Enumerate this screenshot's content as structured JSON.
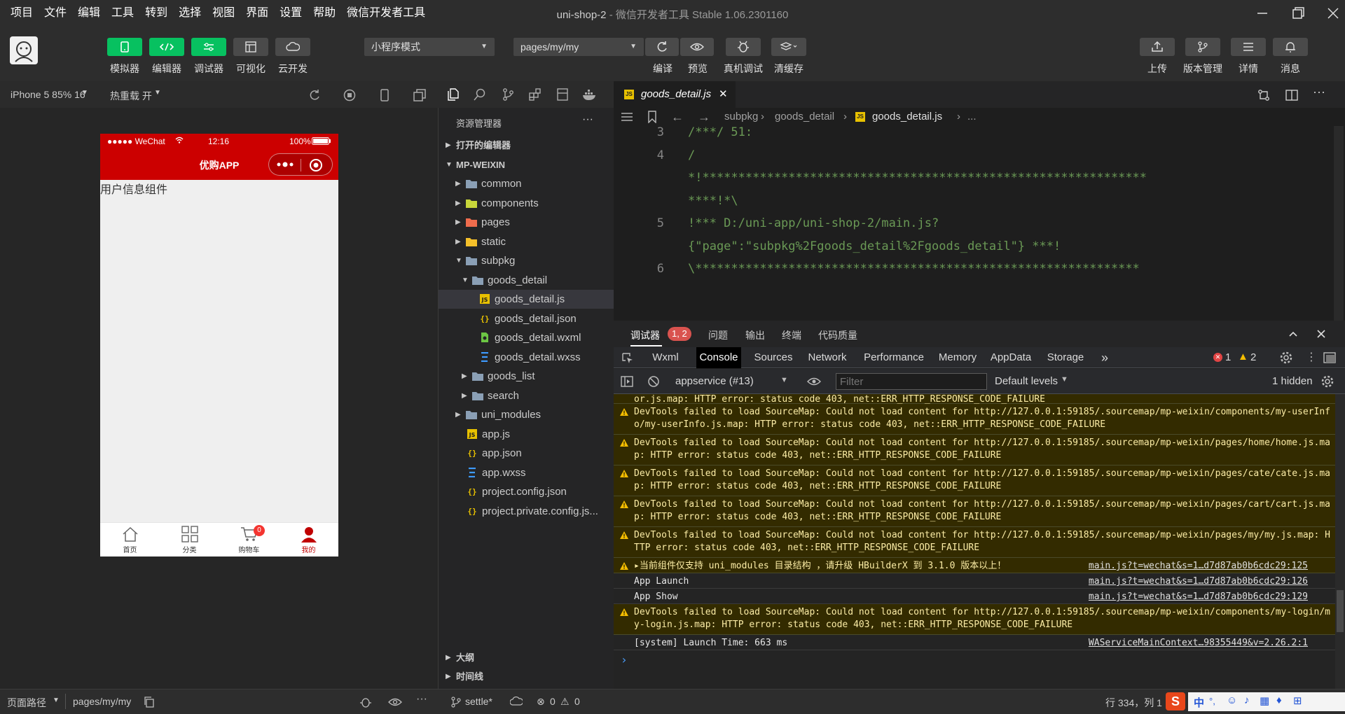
{
  "window": {
    "title": "uni-shop-2",
    "subtitle": "- 微信开发者工具 Stable 1.06.2301160"
  },
  "menu": [
    "项目",
    "文件",
    "编辑",
    "工具",
    "转到",
    "选择",
    "视图",
    "界面",
    "设置",
    "帮助",
    "微信开发者工具"
  ],
  "toolbar": {
    "simulator": "模拟器",
    "editor": "编辑器",
    "debugger": "调试器",
    "visual": "可视化",
    "cloud": "云开发",
    "mode_select": "小程序模式",
    "page_select": "pages/my/my",
    "compile": "编译",
    "preview": "预览",
    "real_debug": "真机调试",
    "clear_cache": "清缓存",
    "upload": "上传",
    "version": "版本管理",
    "details": "详情",
    "messages": "消息"
  },
  "simulator": {
    "device": "iPhone 5 85% 16",
    "hot_reload": "热重载 开",
    "status_carrier": "●●●●● WeChat",
    "status_time": "12:16",
    "status_battery": "100%",
    "nav_title": "优购APP",
    "content_text": "用户信息组件",
    "tabs": [
      {
        "label": "首页",
        "badge": ""
      },
      {
        "label": "分类",
        "badge": ""
      },
      {
        "label": "购物车",
        "badge": "0"
      },
      {
        "label": "我的",
        "badge": ""
      }
    ],
    "accent": "#cc0000"
  },
  "explorer": {
    "title": "资源管理器",
    "open_editors": "打开的编辑器",
    "root": "MP-WEIXIN",
    "items": [
      {
        "name": "common",
        "type": "folder"
      },
      {
        "name": "components",
        "type": "folder"
      },
      {
        "name": "pages",
        "type": "folder"
      },
      {
        "name": "static",
        "type": "folder"
      },
      {
        "name": "subpkg",
        "type": "folder"
      },
      {
        "name": "goods_detail",
        "type": "folder"
      },
      {
        "name": "goods_detail.js",
        "type": "js"
      },
      {
        "name": "goods_detail.json",
        "type": "json"
      },
      {
        "name": "goods_detail.wxml",
        "type": "wxml"
      },
      {
        "name": "goods_detail.wxss",
        "type": "wxss"
      },
      {
        "name": "goods_list",
        "type": "folder"
      },
      {
        "name": "search",
        "type": "folder"
      },
      {
        "name": "uni_modules",
        "type": "folder"
      },
      {
        "name": "app.js",
        "type": "js"
      },
      {
        "name": "app.json",
        "type": "json"
      },
      {
        "name": "app.wxss",
        "type": "wxss"
      },
      {
        "name": "project.config.json",
        "type": "json"
      },
      {
        "name": "project.private.config.js...",
        "type": "json"
      }
    ],
    "outline": "大纲",
    "timeline": "时间线"
  },
  "editor": {
    "tab": "goods_detail.js",
    "breadcrumb": [
      "subpkg",
      "goods_detail",
      "goods_detail.js",
      "..."
    ],
    "lines": [
      {
        "num": "3",
        "text": "/***/ 51:"
      },
      {
        "num": "4",
        "text": "/"
      },
      {
        "num": "",
        "text": "*!**************************************************************"
      },
      {
        "num": "",
        "text": "****!*\\"
      },
      {
        "num": "5",
        "text": "  !*** D:/uni-app/uni-shop-2/main.js?"
      },
      {
        "num": "",
        "text": "  {\"page\":\"subpkg%2Fgoods_detail%2Fgoods_detail\"} ***!"
      },
      {
        "num": "6",
        "text": "  \\**************************************************************"
      }
    ]
  },
  "debugger": {
    "title": "调试器",
    "badge": "1, 2",
    "tabs": [
      "问题",
      "输出",
      "终端",
      "代码质量"
    ],
    "devtools_tabs": [
      "Wxml",
      "Console",
      "Sources",
      "Network",
      "Performance",
      "Memory",
      "AppData",
      "Storage"
    ],
    "more": "»",
    "error_count": "1",
    "warn_count": "2",
    "context": "appservice (#13)",
    "filter_placeholder": "Filter",
    "levels": "Default levels",
    "hidden": "1 hidden",
    "messages": [
      {
        "type": "warn",
        "text": "or.js.map: HTTP error: status code 403, net::ERR_HTTP_RESPONSE_CODE_FAILURE",
        "src": ""
      },
      {
        "type": "warn",
        "text": "DevTools failed to load SourceMap: Could not load content for http://127.0.0.1:59185/.sourcemap/mp-weixin/components/my-userInfo/my-userInfo.js.map: HTTP error: status code 403, net::ERR_HTTP_RESPONSE_CODE_FAILURE",
        "src": ""
      },
      {
        "type": "warn",
        "text": "DevTools failed to load SourceMap: Could not load content for http://127.0.0.1:59185/.sourcemap/mp-weixin/pages/home/home.js.map: HTTP error: status code 403, net::ERR_HTTP_RESPONSE_CODE_FAILURE",
        "src": ""
      },
      {
        "type": "warn",
        "text": "DevTools failed to load SourceMap: Could not load content for http://127.0.0.1:59185/.sourcemap/mp-weixin/pages/cate/cate.js.map: HTTP error: status code 403, net::ERR_HTTP_RESPONSE_CODE_FAILURE",
        "src": ""
      },
      {
        "type": "warn",
        "text": "DevTools failed to load SourceMap: Could not load content for http://127.0.0.1:59185/.sourcemap/mp-weixin/pages/cart/cart.js.map: HTTP error: status code 403, net::ERR_HTTP_RESPONSE_CODE_FAILURE",
        "src": ""
      },
      {
        "type": "warn",
        "text": "DevTools failed to load SourceMap: Could not load content for http://127.0.0.1:59185/.sourcemap/mp-weixin/pages/my/my.js.map: HTTP error: status code 403, net::ERR_HTTP_RESPONSE_CODE_FAILURE",
        "src": ""
      },
      {
        "type": "warn",
        "text": "▸当前组件仅支持 uni_modules 目录结构 ，请升级 HBuilderX 到 3.1.0 版本以上！",
        "src": "main.js?t=wechat&s=1…d7d87ab0b6cdc29:125"
      },
      {
        "type": "log",
        "text": "App Launch",
        "src": "main.js?t=wechat&s=1…d7d87ab0b6cdc29:126"
      },
      {
        "type": "log",
        "text": "App Show",
        "src": "main.js?t=wechat&s=1…d7d87ab0b6cdc29:129"
      },
      {
        "type": "warn",
        "text": "DevTools failed to load SourceMap: Could not load content for http://127.0.0.1:59185/.sourcemap/mp-weixin/components/my-login/my-login.js.map: HTTP error: status code 403, net::ERR_HTTP_RESPONSE_CODE_FAILURE",
        "src": ""
      },
      {
        "type": "log",
        "text": "[system] Launch Time: 663 ms",
        "src": "WAServiceMainContext…98355449&v=2.26.2:1"
      }
    ],
    "prompt": "›"
  },
  "statusbar": {
    "page_path_label": "页面路径",
    "page_path": "pages/my/my",
    "branch": "settle*",
    "errors": "0",
    "warnings": "0",
    "position": "行 334，列 1",
    "ime": "中"
  }
}
